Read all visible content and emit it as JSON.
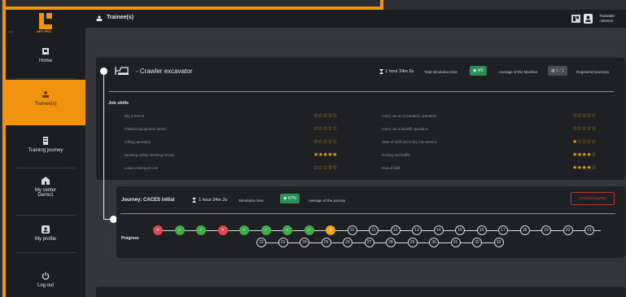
{
  "sidebar": {
    "logo_text": "DEV PRO",
    "items": [
      {
        "label": "Home",
        "icon": "home-icon"
      },
      {
        "label": "Trainee(s)",
        "icon": "trainees-icon",
        "active": true
      },
      {
        "label": "Training journey",
        "icon": "journey-icon"
      },
      {
        "label": "My center",
        "sub": "Demo1",
        "icon": "center-icon"
      },
      {
        "label": "My profile",
        "icon": "profile-icon"
      },
      {
        "label": "Log out",
        "icon": "power-icon"
      }
    ]
  },
  "header": {
    "title": "Trainee(s)",
    "user_name": "Traineder",
    "user_center": "Demo1"
  },
  "machine": {
    "title": "- Crawler excavator",
    "sim_time": "1 hour 24m 2s",
    "sim_time_label": "Total simulation time",
    "average": "4/5",
    "average_label": "Average of the Machine",
    "registered": "1 / 1",
    "registered_label": "Registered journeys",
    "skills_title": "Job skills",
    "skills": [
      {
        "label": "Dig a trench",
        "stars": 0
      },
      {
        "label": "Flatbed equipment carrier",
        "stars": 0
      },
      {
        "label": "Lifting operation",
        "stars": 0
      },
      {
        "label": "Working safely Working Group",
        "stars": 5
      },
      {
        "label": "Load a transport unit",
        "stars": 0
      },
      {
        "label": "Carry out an excavation operation",
        "stars": 0
      },
      {
        "label": "Carry out a backfill operation",
        "stars": 0
      },
      {
        "label": "Start of shift and entry into service",
        "stars": 1
      },
      {
        "label": "Driving and traffic",
        "stars": 4
      },
      {
        "label": "End of shift",
        "stars": 4
      }
    ]
  },
  "journey": {
    "title": "Journey: CACES initial",
    "sim_time": "1 hour 24m 2s",
    "sim_time_label": "Simulation time",
    "average": "67%",
    "average_label": "Average of the journey",
    "action_label": "Archived journey",
    "progress_label": "Progress",
    "steps_row1": [
      "x",
      "v",
      "v",
      "x",
      "v",
      "v",
      "v",
      "v",
      "9",
      "10",
      "11",
      "12",
      "13",
      "14",
      "15",
      "16",
      "17",
      "18",
      "19",
      "20",
      "21"
    ],
    "steps_row2": [
      "22",
      "23",
      "24",
      "25",
      "26",
      "27",
      "28",
      "29",
      "30",
      "31",
      "32",
      "33"
    ]
  },
  "colors": {
    "accent": "#f0930f",
    "success": "#3fae4a",
    "danger": "#e0474a",
    "star": "#f0a21a"
  }
}
